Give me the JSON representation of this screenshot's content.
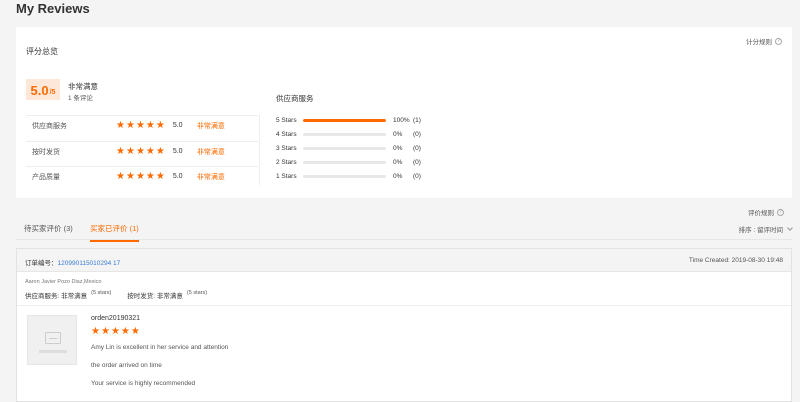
{
  "page_title": "My Reviews",
  "overview": {
    "title": "评分总览",
    "rules_link": "计分规则",
    "score": "5.0",
    "score_unit": "/5",
    "level": "非常满意",
    "count": "1 条评论",
    "ratings": [
      {
        "label": "供应商服务",
        "stars": 5,
        "score": "5.0",
        "level": "非常满意"
      },
      {
        "label": "按时发货",
        "stars": 5,
        "score": "5.0",
        "level": "非常满意"
      },
      {
        "label": "产品质量",
        "stars": 5,
        "score": "5.0",
        "level": "非常满意"
      }
    ],
    "distribution_title": "供应商服务",
    "distribution": [
      {
        "label": "5 Stars",
        "percent": 100,
        "pct_text": "100%",
        "count": "(1)"
      },
      {
        "label": "4 Stars",
        "percent": 0,
        "pct_text": "0%",
        "count": "(0)"
      },
      {
        "label": "3 Stars",
        "percent": 0,
        "pct_text": "0%",
        "count": "(0)"
      },
      {
        "label": "2 Stars",
        "percent": 0,
        "pct_text": "0%",
        "count": "(0)"
      },
      {
        "label": "1 Stars",
        "percent": 0,
        "pct_text": "0%",
        "count": "(0)"
      }
    ]
  },
  "review_rules": "评价规则",
  "tabs": [
    {
      "label": "待买家评价 (3)"
    },
    {
      "label": "买家已评价 (1)"
    }
  ],
  "sort": {
    "label": "排序 : 留评时间"
  },
  "order": {
    "label": "订单编号：",
    "number": "120990115010294 17",
    "time_created": "Time Created: 2019-08-30 19:48",
    "buyer_name": "Aaron Javier Pozo Diaz,Mexico",
    "supplier_label": "供应商服务: 非常满意",
    "supplier_stars": "(5 stars)",
    "delivery_label": "按时发货: 非常满意",
    "delivery_stars": "(5 stars)",
    "review_id": "orden20190321",
    "review_stars": 5,
    "lines": [
      "Amy Lin is excellent in her service and attention",
      "the order arrived on time",
      "Your service is highly recommended"
    ]
  },
  "colors": {
    "accent": "#ff6a00",
    "link": "#3a7bd5"
  },
  "icons": {
    "star": "star-icon",
    "help": "question-icon",
    "image": "image-placeholder-icon"
  }
}
